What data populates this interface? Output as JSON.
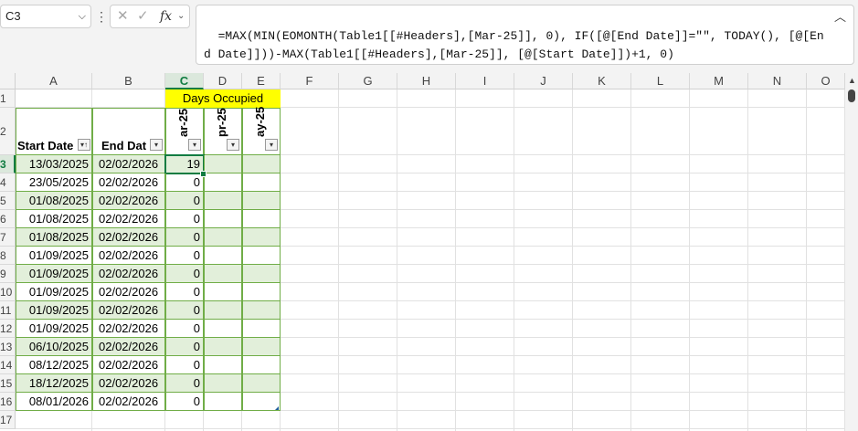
{
  "name_box": {
    "value": "C3"
  },
  "formula_bar": {
    "formula": "=MAX(MIN(EOMONTH(Table1[[#Headers],[Mar-25]], 0), IF([@[End Date]]=\"\", TODAY(), [@[End Date]]))-MAX(Table1[[#Headers],[Mar-25]], [@[Start Date]])+1, 0)",
    "fx_label": "fx",
    "more_label": "⋮"
  },
  "columns": [
    "A",
    "B",
    "C",
    "D",
    "E",
    "F",
    "G",
    "H",
    "I",
    "J",
    "K",
    "L",
    "M",
    "N",
    "O"
  ],
  "rows": [
    "1",
    "2",
    "3",
    "4",
    "5",
    "6",
    "7",
    "8",
    "9",
    "10",
    "11",
    "12",
    "13",
    "14",
    "15",
    "16",
    "17"
  ],
  "banner": {
    "text": "Days Occupied",
    "color": "#ffff00"
  },
  "table": {
    "headers": {
      "start": "Start Date",
      "end": "End Dat",
      "c": "ar-25",
      "d": "pr-25",
      "e": "ay-25"
    },
    "rows": [
      {
        "start": "13/03/2025",
        "end": "02/02/2026",
        "c": "19"
      },
      {
        "start": "23/05/2025",
        "end": "02/02/2026",
        "c": "0"
      },
      {
        "start": "01/08/2025",
        "end": "02/02/2026",
        "c": "0"
      },
      {
        "start": "01/08/2025",
        "end": "02/02/2026",
        "c": "0"
      },
      {
        "start": "01/08/2025",
        "end": "02/02/2026",
        "c": "0"
      },
      {
        "start": "01/09/2025",
        "end": "02/02/2026",
        "c": "0"
      },
      {
        "start": "01/09/2025",
        "end": "02/02/2026",
        "c": "0"
      },
      {
        "start": "01/09/2025",
        "end": "02/02/2026",
        "c": "0"
      },
      {
        "start": "01/09/2025",
        "end": "02/02/2026",
        "c": "0"
      },
      {
        "start": "01/09/2025",
        "end": "02/02/2026",
        "c": "0"
      },
      {
        "start": "06/10/2025",
        "end": "02/02/2026",
        "c": "0"
      },
      {
        "start": "08/12/2025",
        "end": "02/02/2026",
        "c": "0"
      },
      {
        "start": "18/12/2025",
        "end": "02/02/2026",
        "c": "0"
      },
      {
        "start": "08/01/2026",
        "end": "02/02/2026",
        "c": "0"
      }
    ]
  },
  "colors": {
    "accent": "#107c41",
    "band": "#e2efda",
    "table_border": "#70ad47"
  }
}
